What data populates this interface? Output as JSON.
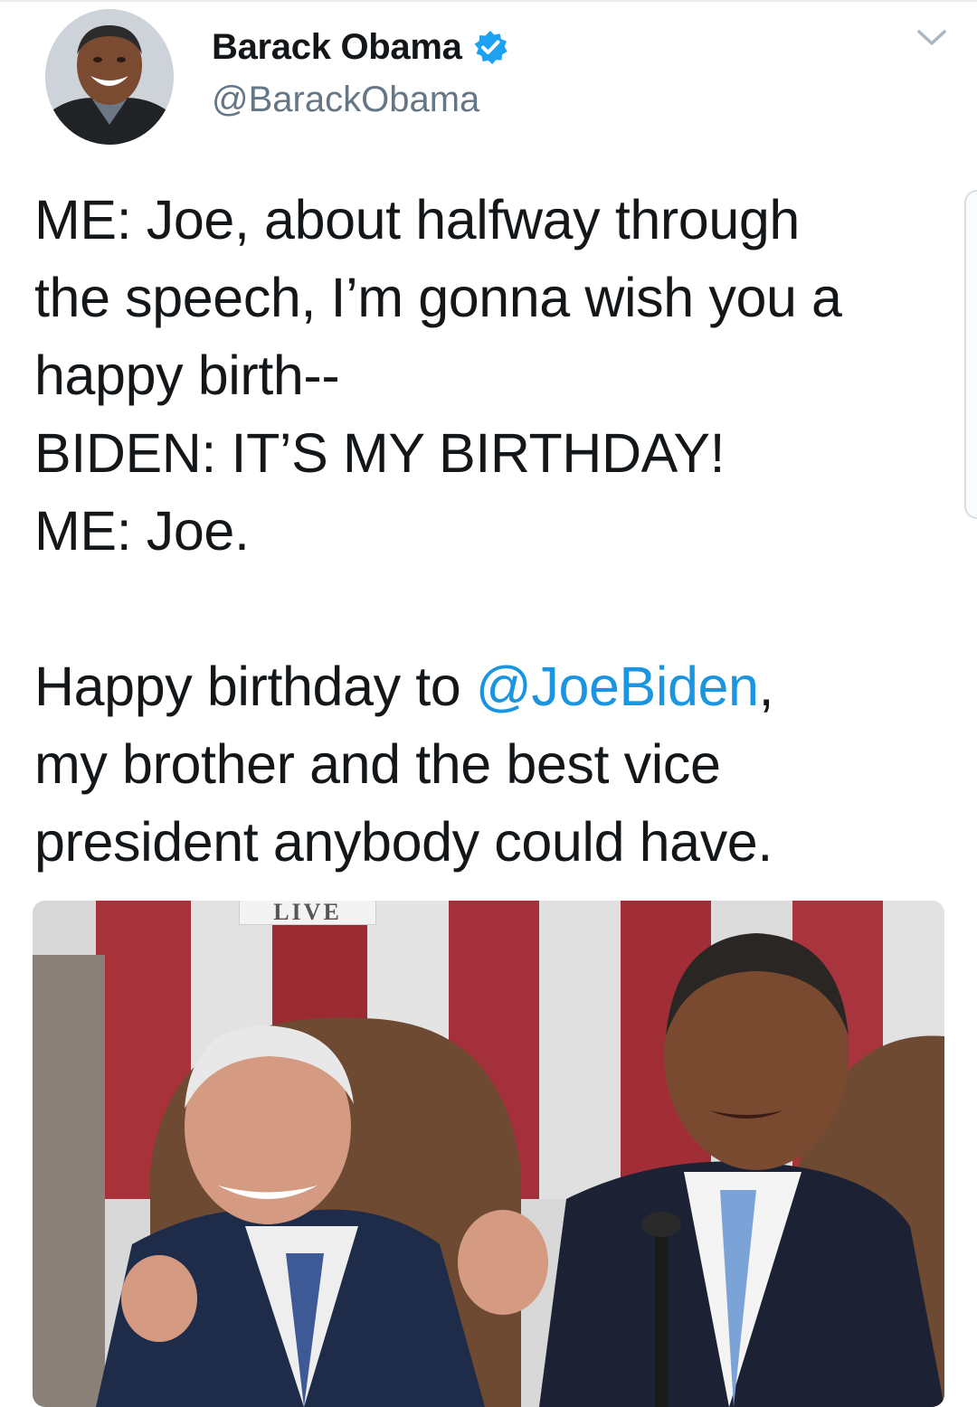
{
  "tweet": {
    "author": {
      "display_name": "Barack Obama",
      "handle": "@BarackObama",
      "verified": true,
      "avatar_icon": "profile-photo"
    },
    "text_lines": [
      "ME:  Joe, about halfway through",
      "the speech, I’m gonna wish you a",
      "happy birth--",
      "BIDEN:  IT’S MY BIRTHDAY!",
      "ME:  Joe."
    ],
    "closing": {
      "prefix": "Happy birthday to ",
      "mention": "@JoeBiden",
      "suffix": ",",
      "line2": "my brother and the best vice",
      "line3": "president anybody could have."
    },
    "media": {
      "badge": "LIVE",
      "type": "gif"
    }
  },
  "icons": {
    "verified": "verified-badge-icon",
    "menu": "chevron-down-icon"
  },
  "colors": {
    "text": "#14171a",
    "secondary_text": "#657786",
    "link": "#1b95e0",
    "verified": "#1da1f2"
  }
}
